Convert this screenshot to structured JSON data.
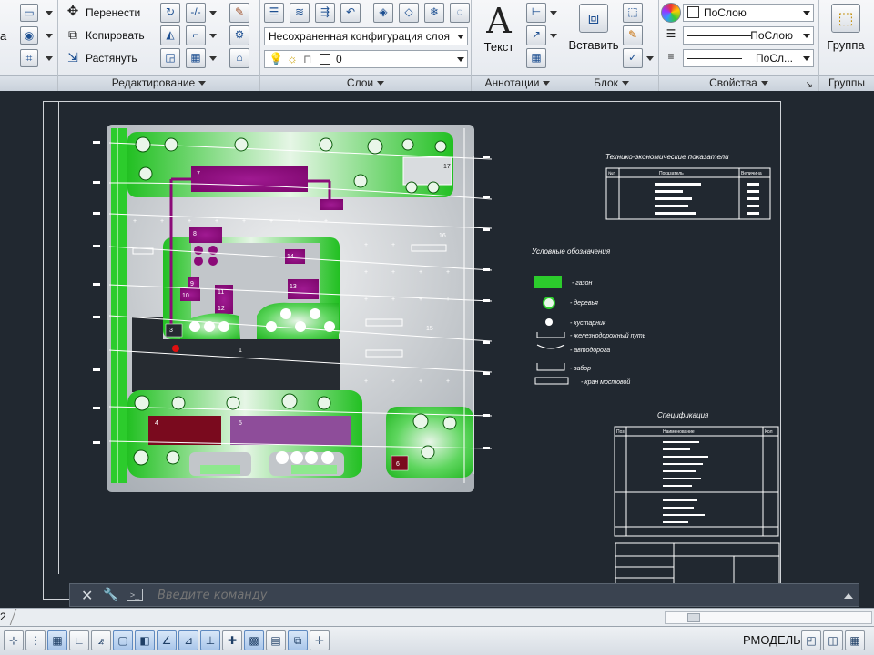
{
  "ribbon": {
    "modify": {
      "title": "Редактирование",
      "move": "Перенести",
      "copy": "Копировать",
      "stretch": "Растянуть",
      "left_cut": "а"
    },
    "layers": {
      "title": "Слои",
      "state_value": "Несохраненная конфигурация слоя",
      "layer_value": "0"
    },
    "annotation": {
      "title": "Аннотации",
      "text_label": "Текст",
      "text_glyph": "A"
    },
    "block": {
      "title": "Блок",
      "insert_label": "Вставить"
    },
    "properties": {
      "title": "Свойства",
      "color_value": "ПоСлою",
      "linetype_value": "ПоСлою",
      "lineweight_value": "ПоСл..."
    },
    "groups": {
      "title": "Группы",
      "group_label": "Группа"
    }
  },
  "drawing": {
    "legend": {
      "title": "Условные обозначения",
      "items": [
        "- газон",
        "- деревья",
        "- кустарник",
        "- железнодорожный путь",
        "- автодорога",
        "- забор",
        "- кран мостовой"
      ]
    },
    "tech_table": {
      "title": "Технико-экономические показатели",
      "headers": [
        "№п",
        "Показатель",
        "Величина"
      ]
    },
    "spec": {
      "title": "Спецификация",
      "headers": [
        "Поз",
        "Наименование",
        "Кол"
      ]
    },
    "labels": {
      "b1": "1",
      "b3": "3",
      "b4": "4",
      "b5": "5",
      "b6": "6",
      "b7": "7",
      "b8": "8",
      "b9": "9",
      "b10": "10",
      "b11": "11",
      "b12": "12",
      "b13": "13",
      "b14": "14",
      "b15": "15",
      "b16": "16",
      "b17": "17"
    }
  },
  "cmd": {
    "placeholder": "Введите команду"
  },
  "tabs": {
    "current": "2"
  },
  "status": {
    "model": "РМОДЕЛЬ"
  },
  "colors": {
    "canvas_bg": "#212830",
    "lawn": "#33cc33",
    "building": "#8b0a78",
    "building_dark": "#7a0a1e",
    "building_light": "#8e4d9a",
    "site": "#bfc4c8"
  }
}
